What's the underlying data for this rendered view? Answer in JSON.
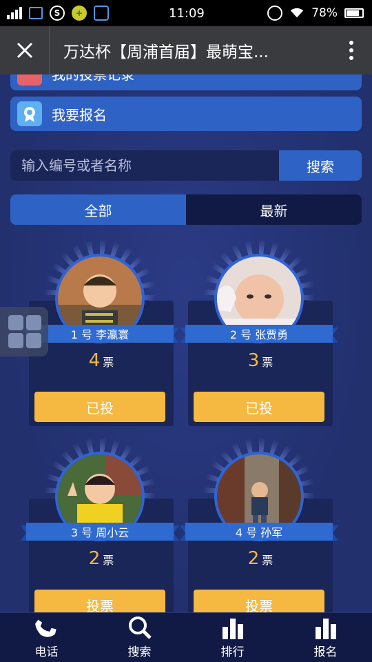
{
  "status_bar": {
    "time": "11:09",
    "battery": "78%"
  },
  "title_bar": {
    "title": "万达杯【周浦首届】最萌宝...",
    "close_label": "×",
    "more_label": "⋮"
  },
  "menu": [
    {
      "label": "我的投票记录"
    },
    {
      "label": "我要报名"
    }
  ],
  "search": {
    "placeholder": "输入编号或者名称",
    "button_label": "搜索"
  },
  "tabs": [
    {
      "label": "全部",
      "active": true
    },
    {
      "label": "最新",
      "active": false
    }
  ],
  "vote_unit": "票",
  "contestants": [
    {
      "label": "1 号 李瀛寰",
      "votes": "4",
      "button": "已投"
    },
    {
      "label": "2 号 张贾勇",
      "votes": "3",
      "button": "已投"
    },
    {
      "label": "3 号 周小云",
      "votes": "2",
      "button": "投票"
    },
    {
      "label": "4 号 孙军",
      "votes": "2",
      "button": "投票"
    }
  ],
  "bottom_nav": [
    {
      "label": "电话",
      "icon": "phone-icon"
    },
    {
      "label": "搜索",
      "icon": "search-icon"
    },
    {
      "label": "排行",
      "icon": "bar-chart-icon"
    },
    {
      "label": "报名",
      "icon": "bar-chart-icon"
    }
  ]
}
